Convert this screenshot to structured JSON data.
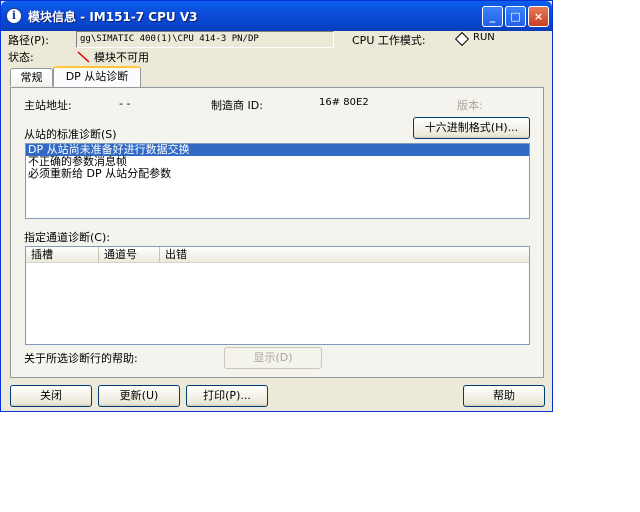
{
  "window": {
    "title": "模块信息 - IM151-7 CPU V3",
    "icon": "info-icon",
    "minimize": "_",
    "maximize": "□",
    "close": "×"
  },
  "header": {
    "path_label": "路径(P):",
    "path_value": "gg\\SIMATIC 400(1)\\CPU 414-3 PN/DP",
    "cpu_mode_label": "CPU 工作模式:",
    "cpu_mode_value": "RUN",
    "status_label": "状态:",
    "status_value": "模块不可用"
  },
  "tabs": [
    {
      "label": "常规"
    },
    {
      "label": "DP 从站诊断"
    }
  ],
  "dp": {
    "master_addr_label": "主站地址:",
    "master_addr_value": "- -",
    "vendor_label": "制造商 ID:",
    "vendor_value": "16# 80E2",
    "version_label": "版本:",
    "hex_button": "十六进制格式(H)...",
    "std_diag_label": "从站的标准诊断(S)",
    "std_diag_items": [
      "DP 从站尚未准备好进行数据交换",
      "不正确的参数消息帧",
      "必须重新给 DP 从站分配参数"
    ],
    "channel_label": "指定通道诊断(C):",
    "channel_columns": [
      "插槽",
      "通道号",
      "出错"
    ],
    "help_label": "关于所选诊断行的帮助:",
    "display_button": "显示(D)"
  },
  "footer": {
    "close": "关闭",
    "update": "更新(U)",
    "print": "打印(P)...",
    "help": "帮助"
  }
}
